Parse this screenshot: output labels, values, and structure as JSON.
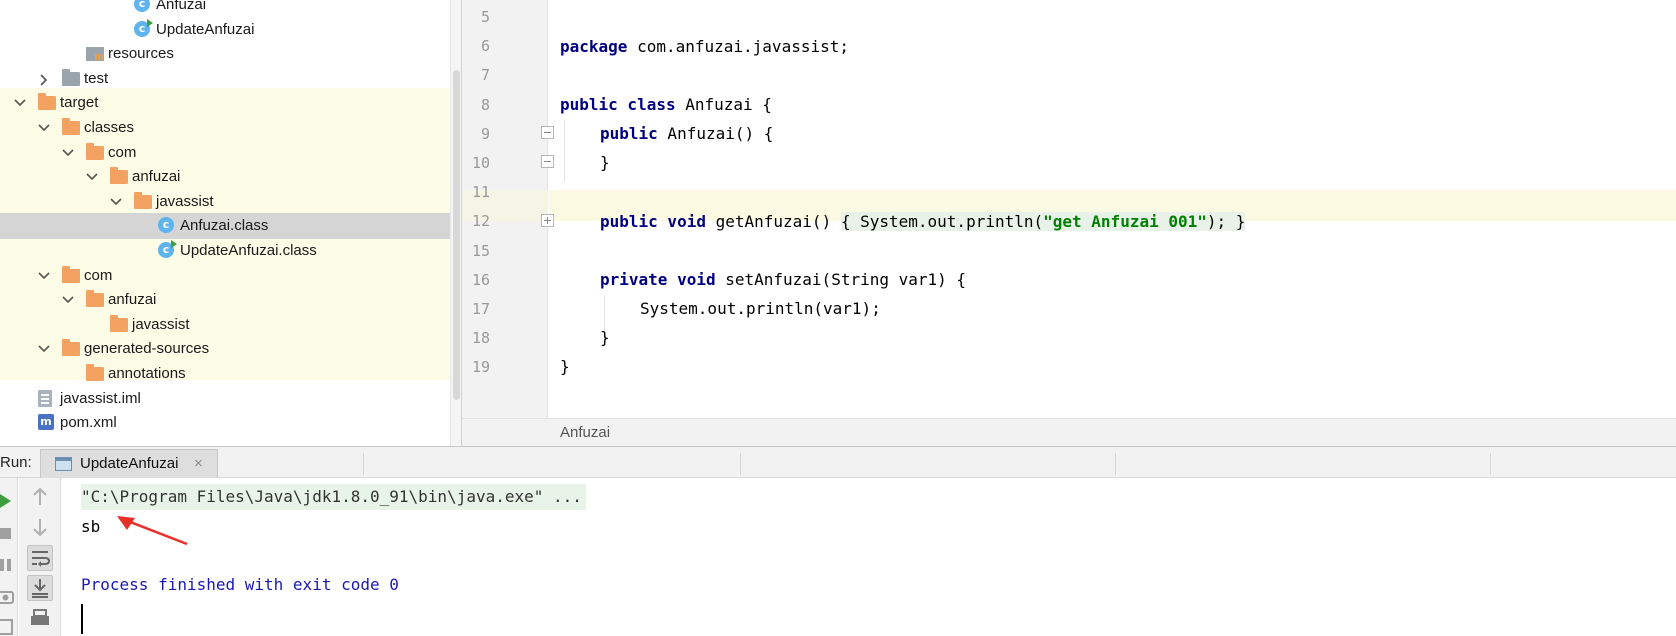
{
  "project_tree": {
    "items": [
      {
        "label": "Anfuzai",
        "icon": "class-icon",
        "indent": 5,
        "arrow": "none"
      },
      {
        "label": "UpdateAnfuzai",
        "icon": "class-run-icon",
        "indent": 5,
        "arrow": "none"
      },
      {
        "label": "resources",
        "icon": "resources-folder-icon",
        "indent": 3,
        "arrow": "none"
      },
      {
        "label": "test",
        "icon": "gray-folder-icon",
        "indent": 2,
        "arrow": "right"
      },
      {
        "label": "target",
        "icon": "folder-icon",
        "indent": 1,
        "arrow": "down"
      },
      {
        "label": "classes",
        "icon": "folder-icon",
        "indent": 2,
        "arrow": "down"
      },
      {
        "label": "com",
        "icon": "folder-icon",
        "indent": 3,
        "arrow": "down"
      },
      {
        "label": "anfuzai",
        "icon": "folder-icon",
        "indent": 4,
        "arrow": "down"
      },
      {
        "label": "javassist",
        "icon": "folder-icon",
        "indent": 5,
        "arrow": "down"
      },
      {
        "label": "Anfuzai.class",
        "icon": "class-icon",
        "indent": 6,
        "arrow": "none",
        "selected": true
      },
      {
        "label": "UpdateAnfuzai.class",
        "icon": "class-run-icon",
        "indent": 6,
        "arrow": "none"
      },
      {
        "label": "com",
        "icon": "folder-icon",
        "indent": 2,
        "arrow": "down"
      },
      {
        "label": "anfuzai",
        "icon": "folder-icon",
        "indent": 3,
        "arrow": "down"
      },
      {
        "label": "javassist",
        "icon": "folder-icon",
        "indent": 4,
        "arrow": "none"
      },
      {
        "label": "generated-sources",
        "icon": "folder-icon",
        "indent": 2,
        "arrow": "down"
      },
      {
        "label": "annotations",
        "icon": "folder-icon",
        "indent": 3,
        "arrow": "none"
      },
      {
        "label": "javassist.iml",
        "icon": "file-icon",
        "indent": 1,
        "arrow": "none"
      },
      {
        "label": "pom.xml",
        "icon": "maven-file-icon",
        "indent": 1,
        "arrow": "none"
      }
    ]
  },
  "editor": {
    "line_numbers": [
      "5",
      "6",
      "7",
      "8",
      "9",
      "10",
      "11",
      "12",
      "15",
      "16",
      "17",
      "18",
      "19"
    ],
    "code": {
      "l6_kw": "package",
      "l6_rest": " com.anfuzai.javassist;",
      "l8_kw": "public class",
      "l8_rest": " Anfuzai {",
      "l9_kw": "public",
      "l9_rest": " Anfuzai() {",
      "l10": "}",
      "l12_kw": "public void",
      "l12_name": " getAnfuzai() ",
      "l12_open": "{",
      "l12_call": " System.out.println(",
      "l12_str": "\"get Anfuzai 001\"",
      "l12_end": "); ",
      "l12_close": "}",
      "l16_kw": "private void",
      "l16_rest": " setAnfuzai(String var1) {",
      "l17": "System.out.println(var1);",
      "l18": "}",
      "l19": "}"
    },
    "breadcrumb": "Anfuzai"
  },
  "run_panel": {
    "title": "Run:",
    "tab_label": "UpdateAnfuzai",
    "tab_close": "×",
    "console": {
      "command": "\"C:\\Program Files\\Java\\jdk1.8.0_91\\bin\\java.exe\" ...",
      "output": "sb",
      "exit": "Process finished with exit code 0"
    }
  },
  "colors": {
    "keyword": "#000080",
    "string": "#008000",
    "exit_message": "#1a1ab0",
    "annotation_arrow": "#e8302a",
    "folder": "#f4a261",
    "class_icon": "#5fb4ee"
  }
}
